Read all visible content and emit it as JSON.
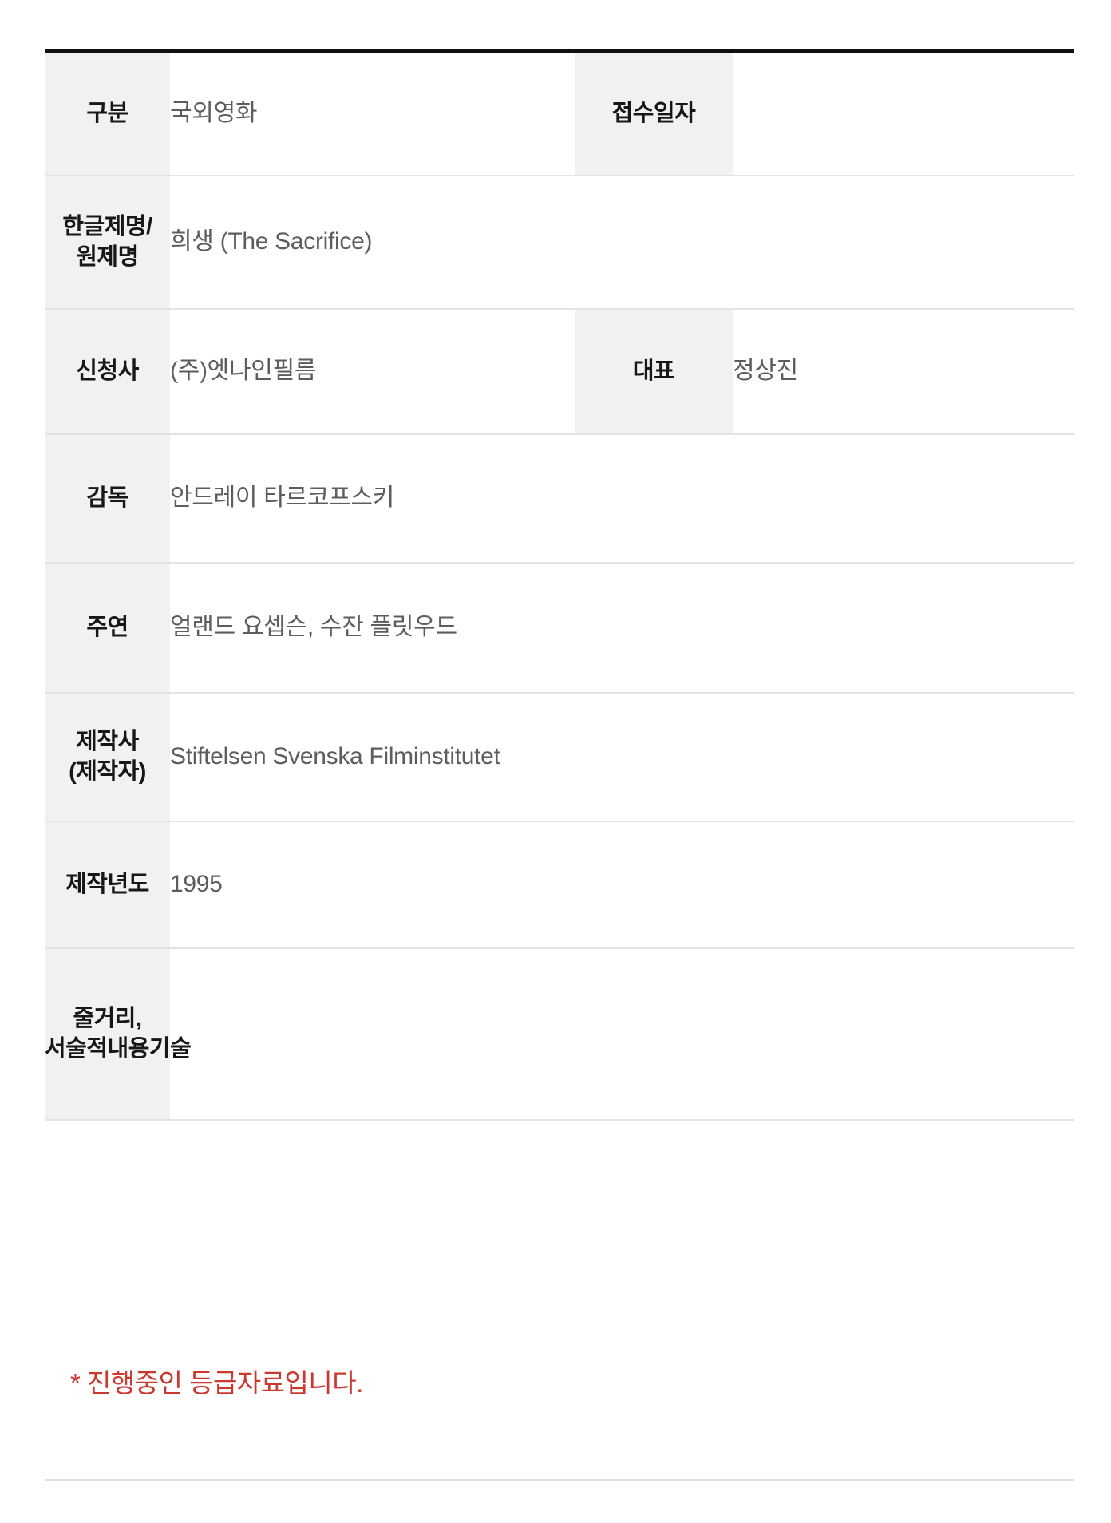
{
  "document": {
    "type": "film-rating-application-detail",
    "colors": {
      "label_background": "#f1f1f1",
      "value_text": "#5d5d5d",
      "label_text": "#171717",
      "top_border": "#111111",
      "row_divider": "#e3e3e3",
      "notice_red": "#c9392f"
    }
  },
  "table": {
    "rows": [
      {
        "label": "구분",
        "value": "국외영화",
        "label2": "접수일자",
        "value2": ""
      },
      {
        "label": "한글제명/원제명",
        "value": "희생 (The Sacrifice)",
        "label2": "",
        "value2": ""
      },
      {
        "label": "신청사",
        "value": "(주)엣나인필름",
        "label2": "대표",
        "value2": "정상진"
      },
      {
        "label": "감독",
        "value": "안드레이 타르코프스키",
        "label2": "",
        "value2": ""
      },
      {
        "label": "주연",
        "value": "얼랜드 요셉슨, 수잔 플릿우드",
        "label2": "",
        "value2": ""
      },
      {
        "label": "제작사(제작자)",
        "label_line1": "제작사",
        "label_line2": "(제작자)",
        "value": "Stiftelsen Svenska Filminstitutet",
        "label2": "",
        "value2": ""
      },
      {
        "label": "제작년도",
        "value": "1995",
        "label2": "",
        "value2": ""
      },
      {
        "label": "줄거리, 서술적내용기술",
        "value": "",
        "label2": "",
        "value2": ""
      }
    ]
  },
  "notice": {
    "text": "* 진행중인 등급자료입니다."
  }
}
